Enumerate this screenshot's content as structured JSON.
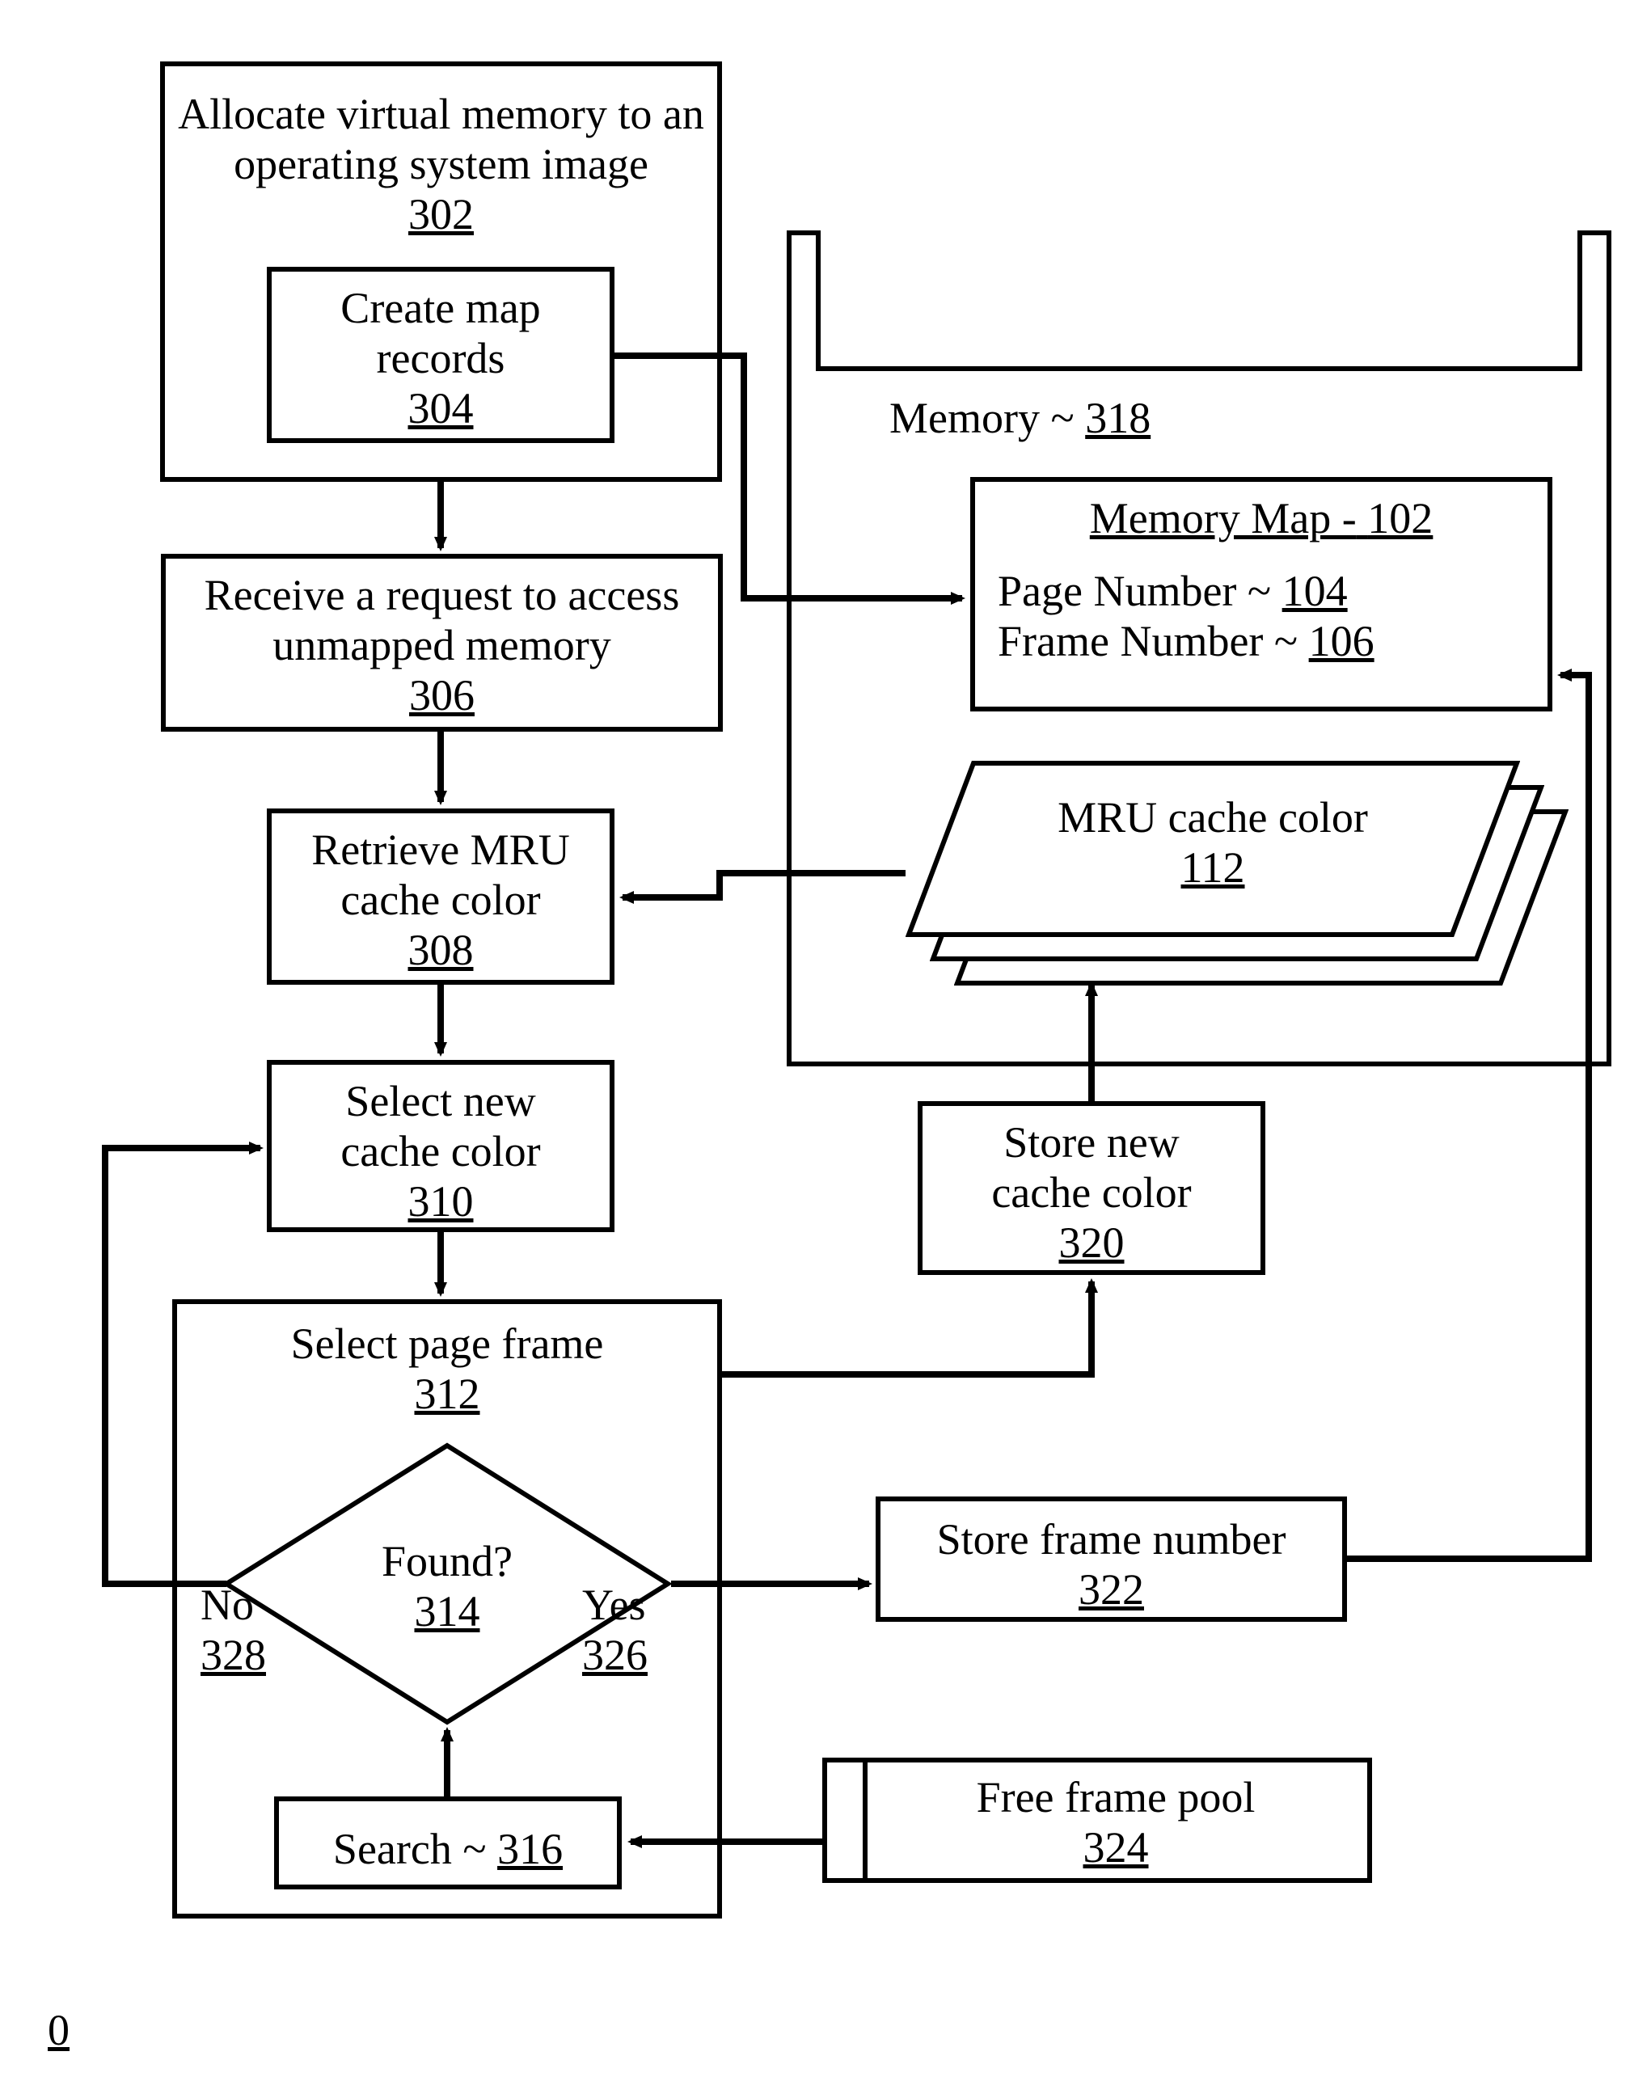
{
  "n302": {
    "line1": "Allocate virtual memory to an",
    "line2": "operating system image",
    "ref": "302"
  },
  "n304": {
    "line1": "Create map",
    "line2": "records",
    "ref": "304"
  },
  "n306": {
    "line1": "Receive a request to access",
    "line2": "unmapped memory",
    "ref": "306"
  },
  "n308": {
    "line1": "Retrieve MRU",
    "line2": "cache color",
    "ref": "308"
  },
  "n310": {
    "line1": "Select new",
    "line2": "cache color",
    "ref": "310"
  },
  "n312": {
    "line1": "Select page frame",
    "ref": "312"
  },
  "n314": {
    "q": "Found?",
    "ref": "314"
  },
  "n316": {
    "label": "Search ~",
    "ref": "316"
  },
  "n318": {
    "label": "Memory ~",
    "ref": "318"
  },
  "n102": {
    "title": "Memory Map -",
    "ref": "102",
    "pn_label": "Page Number ~",
    "pn_ref": "104",
    "fn_label": "Frame Number ~",
    "fn_ref": "106"
  },
  "n112": {
    "line1": "MRU cache color",
    "ref": "112"
  },
  "n320": {
    "line1": "Store new",
    "line2": "cache color",
    "ref": "320"
  },
  "n322": {
    "line1": "Store frame number",
    "ref": "322"
  },
  "n324": {
    "line1": "Free frame pool",
    "ref": "324"
  },
  "yes": {
    "label": "Yes",
    "ref": "326"
  },
  "no": {
    "label": "No",
    "ref": "328"
  },
  "fig": {
    "ref": "0"
  }
}
